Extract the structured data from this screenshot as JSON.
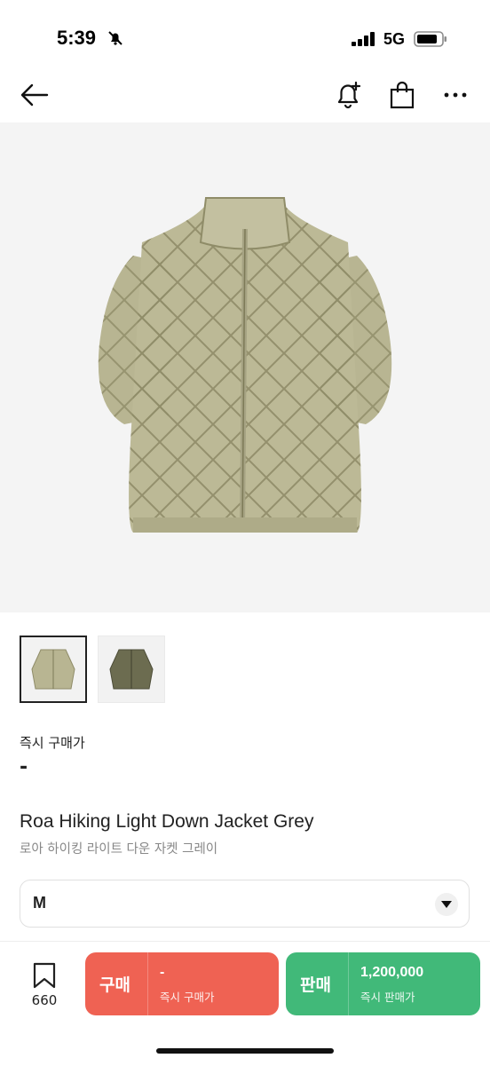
{
  "status_bar": {
    "time": "5:39",
    "network": "5G"
  },
  "nav": {
    "back_icon": "arrow-left-icon",
    "notify_icon": "bell-plus-icon",
    "bag_icon": "shopping-bag-icon",
    "more_icon": "more-horizontal-icon"
  },
  "product": {
    "instant_buy_label": "즉시 구매가",
    "instant_buy_price": "-",
    "name": "Roa Hiking Light Down Jacket Grey",
    "name_kr": "로아 하이킹 라이트 다운 자켓 그레이",
    "colors": {
      "jacket_light": "#b8b592",
      "jacket_dark": "#6c6c50"
    }
  },
  "size": {
    "selected": "M"
  },
  "bottom": {
    "wish_count": "660",
    "buy": {
      "label": "구매",
      "price": "-",
      "sub": "즉시 구매가",
      "color": "#ef6253"
    },
    "sell": {
      "label": "판매",
      "price": "1,200,000",
      "sub": "즉시 판매가",
      "color": "#41b979"
    }
  }
}
